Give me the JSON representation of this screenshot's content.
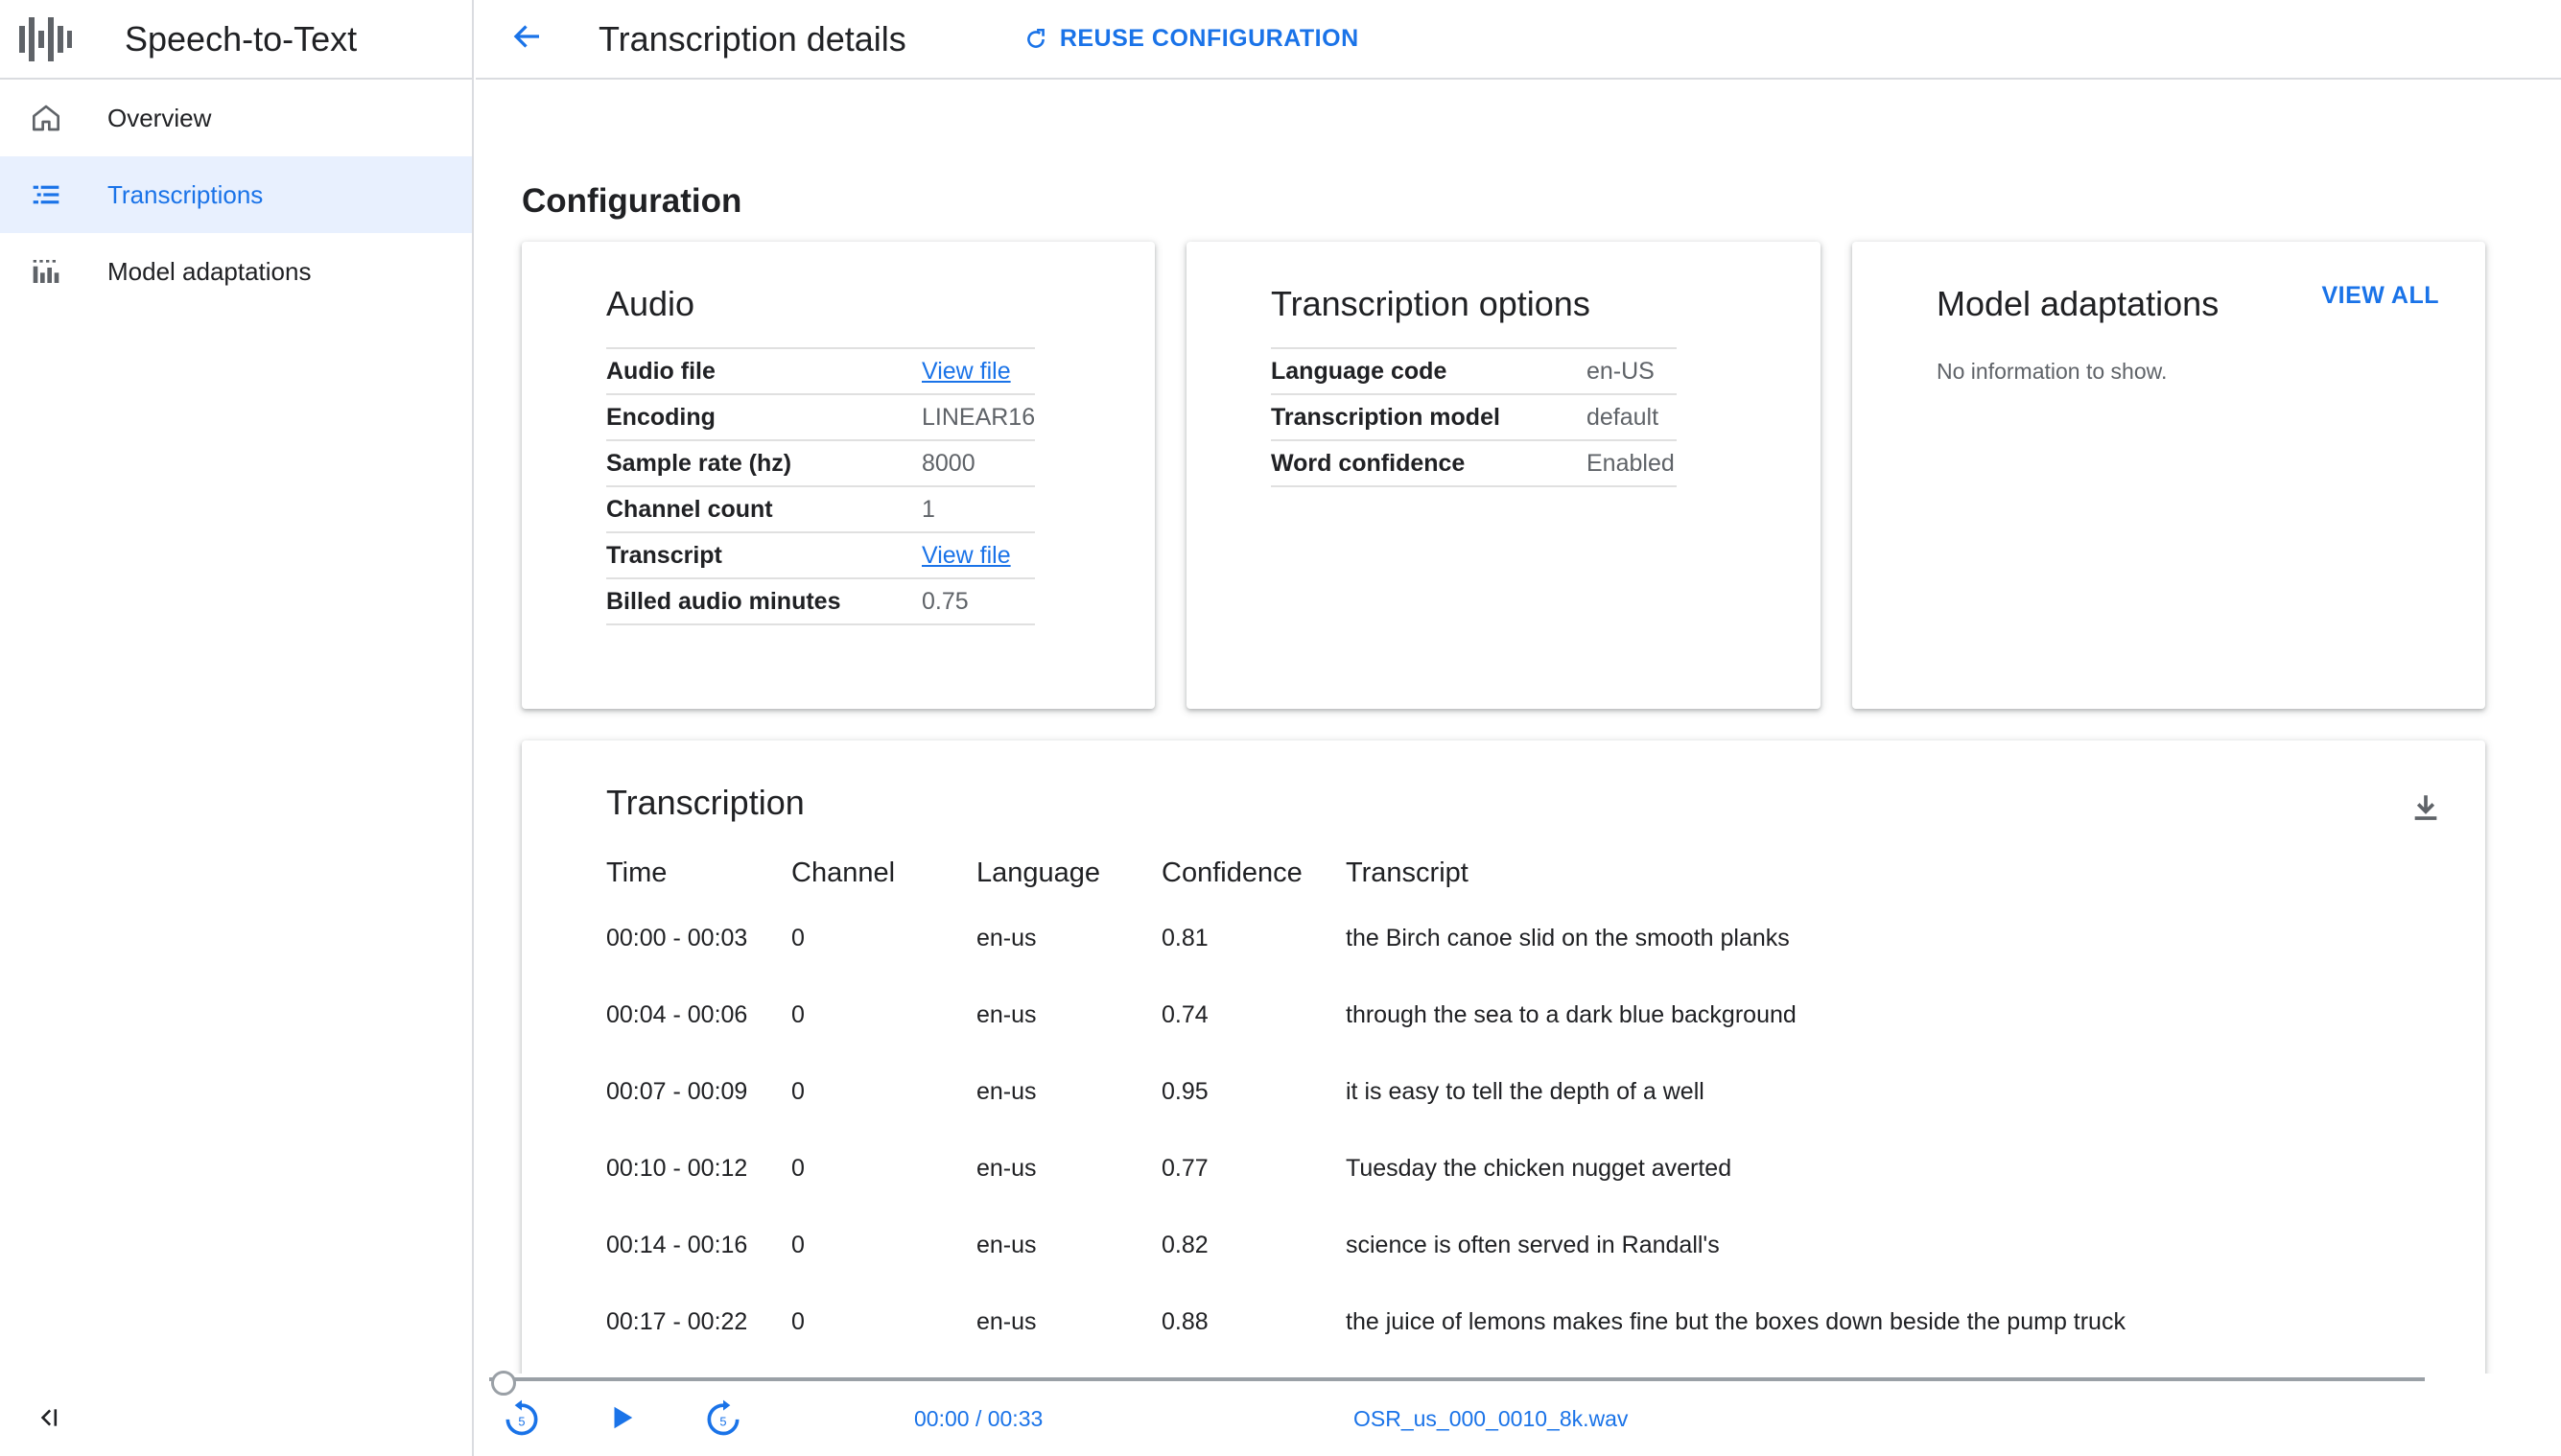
{
  "app": {
    "title": "Speech-to-Text"
  },
  "sidebar": {
    "items": [
      {
        "label": "Overview",
        "icon": "home-icon"
      },
      {
        "label": "Transcriptions",
        "icon": "list-icon",
        "active": true
      },
      {
        "label": "Model adaptations",
        "icon": "model-icon"
      }
    ],
    "collapse_icon": "collapse-icon"
  },
  "header": {
    "title": "Transcription details",
    "reuse_label": "REUSE CONFIGURATION"
  },
  "main": {
    "section_title": "Configuration",
    "audio_card": {
      "title": "Audio",
      "rows": [
        {
          "key": "Audio file",
          "value": "View file",
          "link": true
        },
        {
          "key": "Encoding",
          "value": "LINEAR16"
        },
        {
          "key": "Sample rate (hz)",
          "value": "8000"
        },
        {
          "key": "Channel count",
          "value": "1"
        },
        {
          "key": "Transcript",
          "value": "View file",
          "link": true
        },
        {
          "key": "Billed audio minutes",
          "value": "0.75"
        }
      ]
    },
    "options_card": {
      "title": "Transcription options",
      "rows": [
        {
          "key": "Language code",
          "value": "en-US"
        },
        {
          "key": "Transcription model",
          "value": "default"
        },
        {
          "key": "Word confidence",
          "value": "Enabled"
        }
      ]
    },
    "adaptations_card": {
      "title": "Model adaptations",
      "view_all": "VIEW ALL",
      "empty": "No information to show."
    },
    "transcription": {
      "title": "Transcription",
      "columns": [
        "Time",
        "Channel",
        "Language",
        "Confidence",
        "Transcript"
      ],
      "rows": [
        {
          "time": "00:00 - 00:03",
          "channel": "0",
          "language": "en-us",
          "confidence": "0.81",
          "transcript": "the Birch canoe slid on the smooth planks"
        },
        {
          "time": "00:04 - 00:06",
          "channel": "0",
          "language": "en-us",
          "confidence": "0.74",
          "transcript": "through the sea to a dark blue background"
        },
        {
          "time": "00:07 - 00:09",
          "channel": "0",
          "language": "en-us",
          "confidence": "0.95",
          "transcript": "it is easy to tell the depth of a well"
        },
        {
          "time": "00:10 - 00:12",
          "channel": "0",
          "language": "en-us",
          "confidence": "0.77",
          "transcript": "Tuesday the chicken nugget averted"
        },
        {
          "time": "00:14 - 00:16",
          "channel": "0",
          "language": "en-us",
          "confidence": "0.82",
          "transcript": "science is often served in Randall's"
        },
        {
          "time": "00:17 - 00:22",
          "channel": "0",
          "language": "en-us",
          "confidence": "0.88",
          "transcript": "the juice of lemons makes fine but the boxes down beside the pump truck"
        }
      ]
    }
  },
  "player": {
    "time": "00:00 / 00:33",
    "file": "OSR_us_000_0010_8k.wav",
    "progress": 0,
    "replay_seconds": "5",
    "forward_seconds": "5"
  },
  "colors": {
    "accent": "#1a73e8",
    "active_bg": "#e8f0fe",
    "divider": "#dadce0",
    "text": "#202124",
    "muted": "#5f6368"
  }
}
